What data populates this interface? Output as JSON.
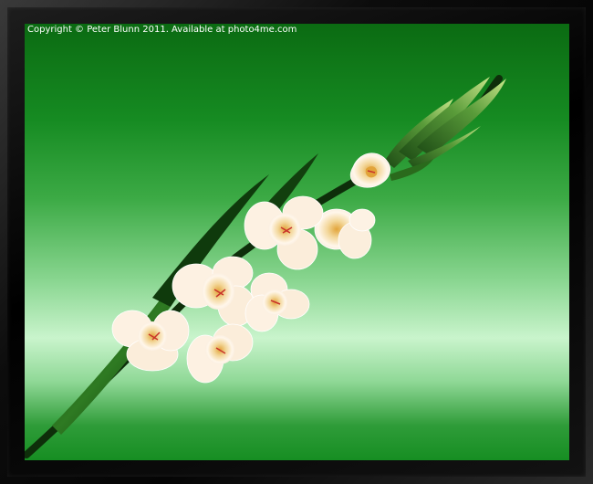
{
  "image": {
    "copyright_text": "Copyright © Peter Blunn 2011. Available at photo4me.com",
    "subject": "gladiolus-flower-spike",
    "colors": {
      "background_dark": "#0b6b12",
      "background_light": "#c9f4cc",
      "frame": "#0a0a0a",
      "petal": "#fbeedc",
      "petal_center": "#e9b84a",
      "leaf": "#1f5a1a"
    }
  }
}
